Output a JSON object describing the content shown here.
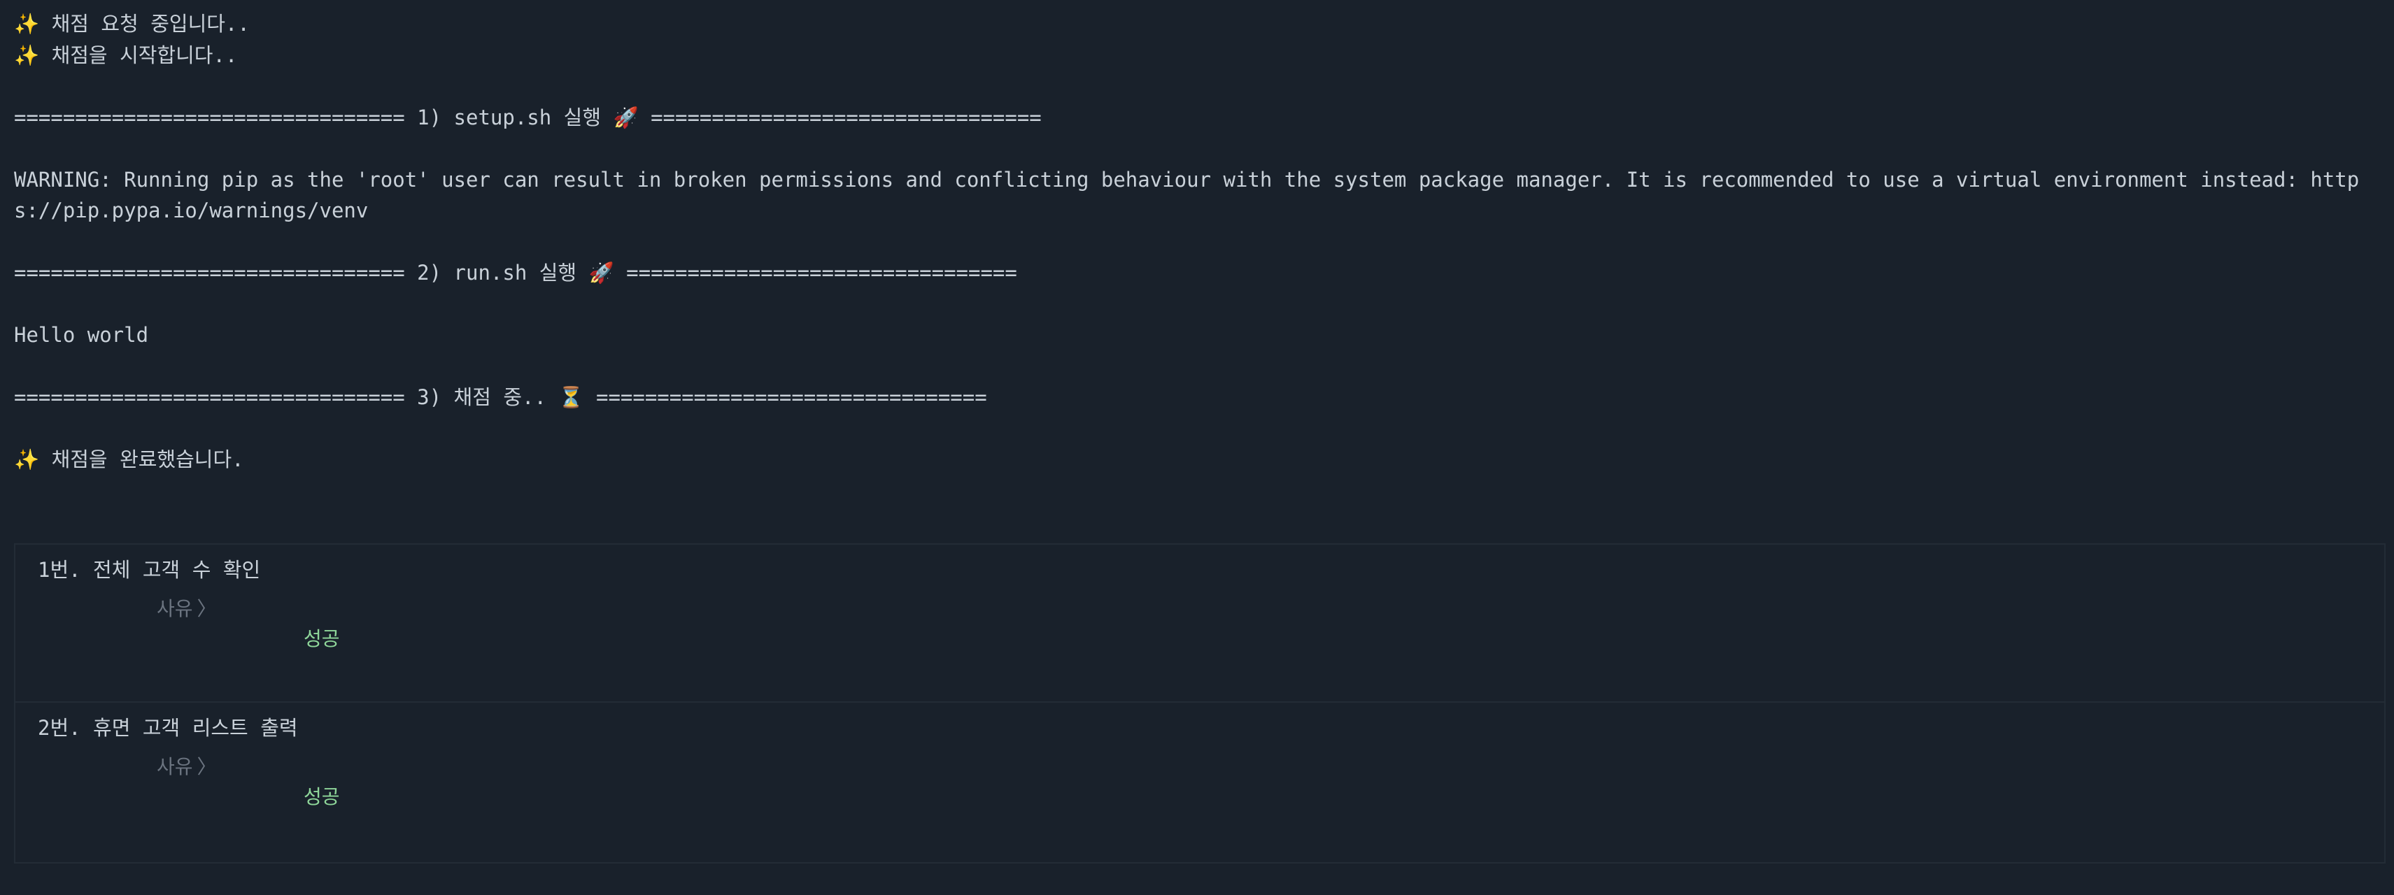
{
  "console": {
    "lines": [
      "✨ 채점 요청 중입니다..",
      "✨ 채점을 시작합니다..",
      "",
      "================================ 1) setup.sh 실행 🚀 ================================",
      "",
      "WARNING: Running pip as the 'root' user can result in broken permissions and conflicting behaviour with the system package manager. It is recommended to use a virtual environment instead: https://pip.pypa.io/warnings/venv",
      "",
      "================================ 2) run.sh 실행 🚀 ================================",
      "",
      "Hello world",
      "",
      "================================ 3) 채점 중.. ⏳ ================================",
      "",
      "✨ 채점을 완료했습니다."
    ]
  },
  "results": [
    {
      "title": "1번. 전체 고객 수 확인",
      "reason_label": "사유",
      "reason_chevron": "〉",
      "status": "성공"
    },
    {
      "title": "2번. 휴면 고객 리스트 출력",
      "reason_label": "사유",
      "reason_chevron": "〉",
      "status": "성공"
    }
  ],
  "colors": {
    "background": "#19212b",
    "text": "#c9d1d9",
    "muted": "#6b7480",
    "success": "#8fd79a",
    "border": "#232c36"
  }
}
